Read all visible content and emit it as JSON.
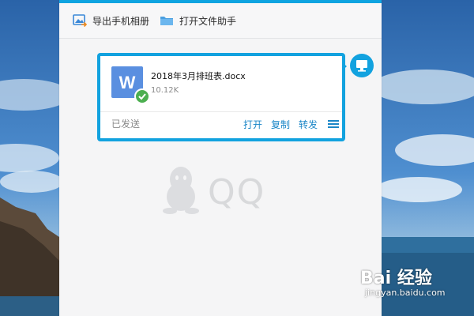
{
  "toolbar": {
    "export_album_label": "导出手机相册",
    "open_file_helper_label": "打开文件助手"
  },
  "message": {
    "file_name": "2018年3月排班表.docx",
    "file_size": "10.12K",
    "status": "已发送",
    "actions": {
      "open": "打开",
      "copy": "复制",
      "forward": "转发"
    },
    "file_icon_letter": "W"
  },
  "watermark": {
    "app_name": "QQ"
  },
  "baidu": {
    "logo_text": "Bai 经验",
    "url": "jingyan.baidu.com"
  },
  "colors": {
    "accent": "#12a2df",
    "link": "#1a86c7",
    "file_icon": "#5a8fe0",
    "check": "#4caf50"
  },
  "icons": {
    "export_album": "picture-export-icon",
    "file_helper": "folder-icon",
    "file_type": "word-doc-icon",
    "sent_check": "check-icon",
    "menu": "hamburger-menu-icon",
    "device": "computer-monitor-icon",
    "qq_logo": "penguin-icon"
  }
}
